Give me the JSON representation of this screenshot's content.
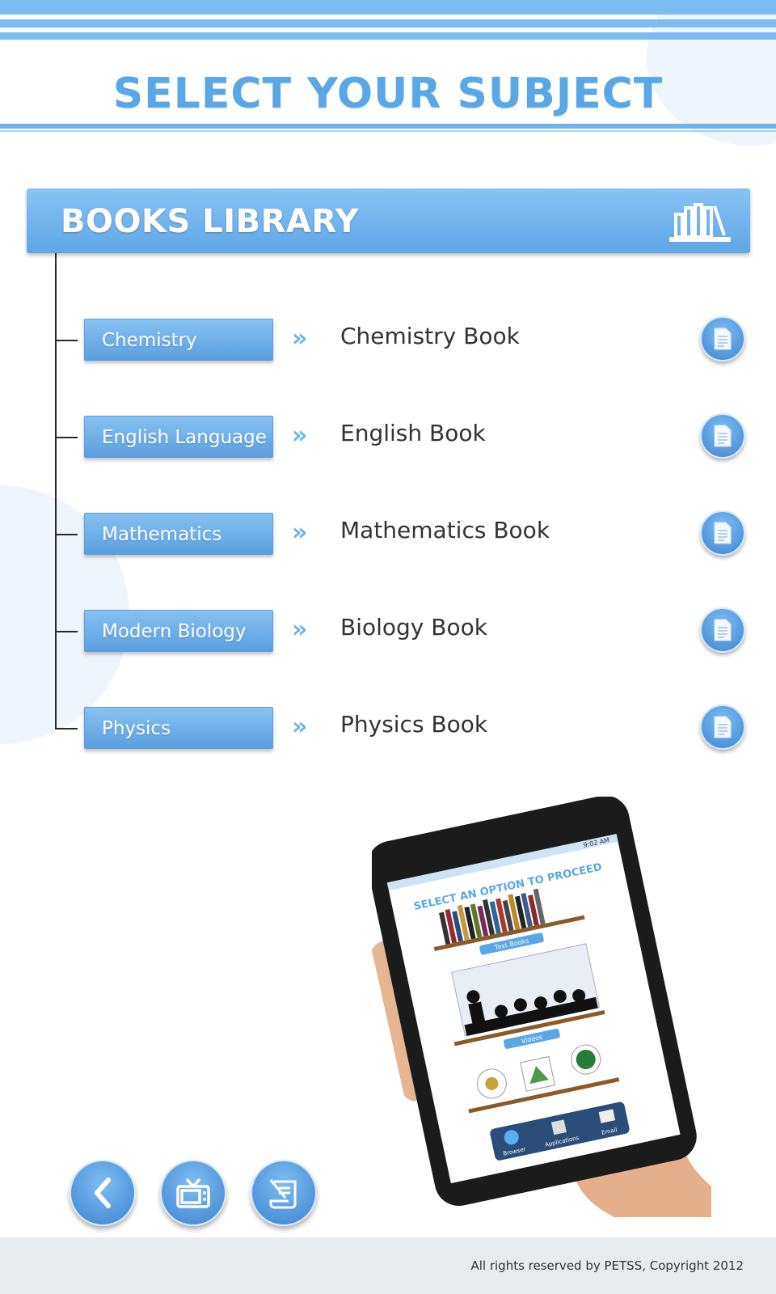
{
  "header": {
    "title": "SELECT YOUR SUBJECT"
  },
  "library": {
    "title": "BOOKS LIBRARY",
    "icon": "bookshelf-icon"
  },
  "subjects": [
    {
      "label": "Chemistry",
      "book": "Chemistry Book",
      "icon": "document-icon"
    },
    {
      "label": "English Language",
      "book": "English Book",
      "icon": "document-icon"
    },
    {
      "label": "Mathematics",
      "book": "Mathematics Book",
      "icon": "document-icon"
    },
    {
      "label": "Modern Biology",
      "book": "Biology Book",
      "icon": "document-icon"
    },
    {
      "label": "Physics",
      "book": "Physics Book",
      "icon": "document-icon"
    }
  ],
  "chevron_glyph": "»",
  "tablet_screen": {
    "status_time": "9:02 AM",
    "heading": "SELECT AN OPTION TO PROCEED",
    "options": [
      "Text Books",
      "Videos"
    ],
    "dock": [
      "Browser",
      "Applications",
      "Email"
    ]
  },
  "nav": {
    "back_icon": "chevron-left-icon",
    "tv_icon": "tv-icon",
    "exam_icon": "exam-scroll-icon"
  },
  "colors": {
    "accent": "#5aa7e6",
    "button": "#6aafeb",
    "footer_bg": "#e7ebee"
  },
  "footer": {
    "copyright": "All rights reserved by PETSS, Copyright 2012"
  }
}
